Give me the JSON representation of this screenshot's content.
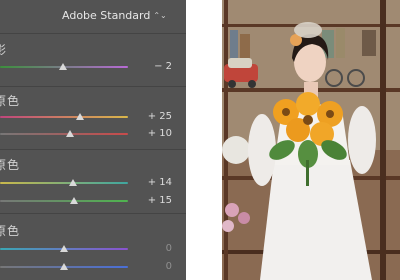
{
  "panel": {
    "profile": {
      "label": "Adobe Standard",
      "chevron": "⌃⌄"
    },
    "shadows": {
      "label": "影",
      "tint": {
        "value": "− 2",
        "level": -2,
        "gradient": [
          "#3c8f3c",
          "#b86ad6"
        ]
      }
    },
    "red_primary": {
      "label": "原色",
      "hue": {
        "value": "+ 25",
        "level": 25,
        "gradient": [
          "#c0467c",
          "#d9b74a"
        ]
      },
      "saturation": {
        "value": "+ 10",
        "level": 10,
        "gradient": [
          "#777777",
          "#c84b4b"
        ]
      }
    },
    "green_primary": {
      "label": "原色",
      "hue": {
        "value": "+ 14",
        "level": 14,
        "gradient": [
          "#c9b84c",
          "#3fa6a0"
        ]
      },
      "saturation": {
        "value": "+ 15",
        "level": 15,
        "gradient": [
          "#777777",
          "#4fb44f"
        ]
      }
    },
    "blue_primary": {
      "label": "原色",
      "hue": {
        "value": "0",
        "level": 0,
        "gradient": [
          "#3aa7b4",
          "#8a52cf"
        ]
      },
      "saturation": {
        "value": "0",
        "level": 0,
        "gradient": [
          "#777777",
          "#4a6fd8"
        ]
      }
    }
  },
  "colors": {
    "panel_bg": "#535353",
    "text": "#dcdcdc",
    "thumb": "#d9d9d9"
  },
  "photo": {
    "subject": "woman in white dress holding sunflower bouquet in vintage room"
  }
}
